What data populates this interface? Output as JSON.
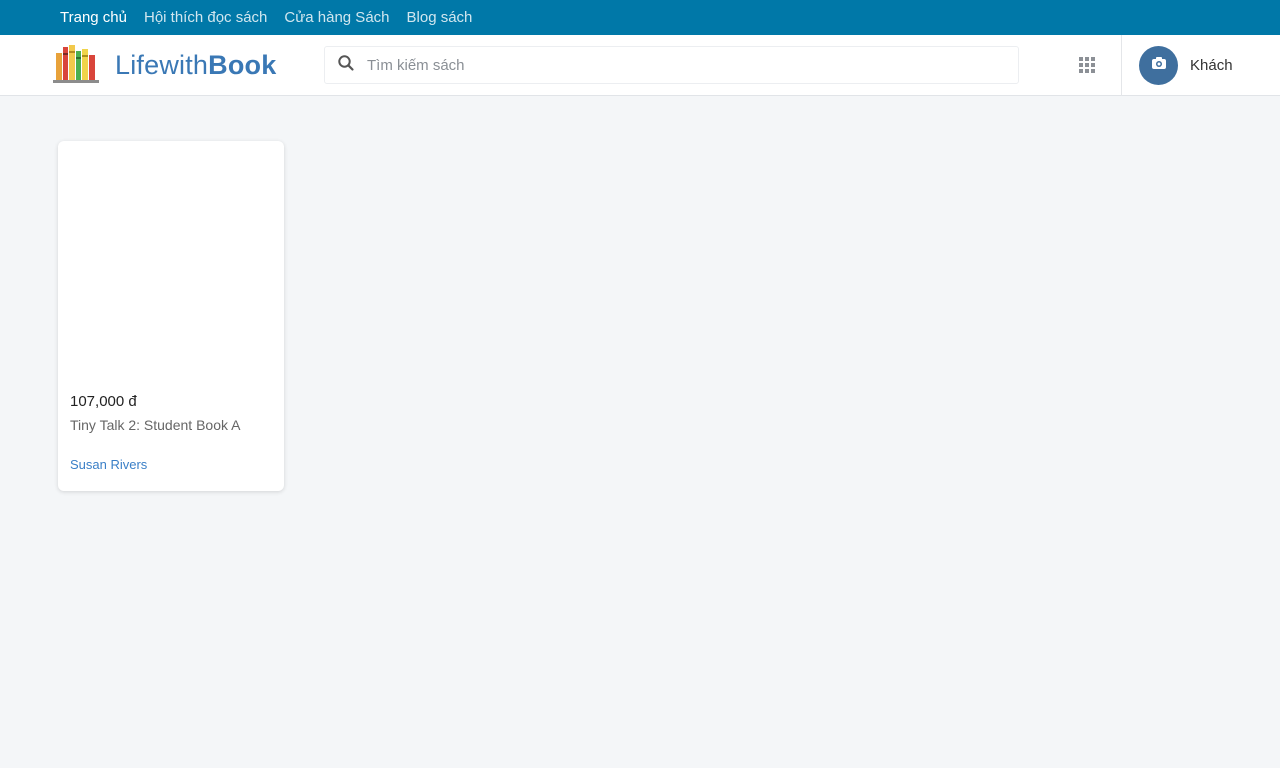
{
  "topnav": {
    "items": [
      {
        "label": "Trang chủ"
      },
      {
        "label": "Hội thích đọc sách"
      },
      {
        "label": "Cửa hàng Sách"
      },
      {
        "label": "Blog sách"
      }
    ]
  },
  "header": {
    "logo": {
      "text_light": "Lifewith",
      "text_bold": "Book",
      "icon": "bookshelf-icon"
    },
    "search": {
      "placeholder": "Tìm kiếm sách",
      "value": ""
    },
    "user": {
      "name": "Khách",
      "avatar_icon": "camera-icon"
    },
    "colors": {
      "nav_bg": "#0078a8",
      "brand": "#3a78b5",
      "avatar_bg": "#3f6f9e"
    }
  },
  "products": [
    {
      "price": "107,000 đ",
      "title": "Tiny Talk 2: Student Book A",
      "author": "Susan Rivers"
    }
  ]
}
